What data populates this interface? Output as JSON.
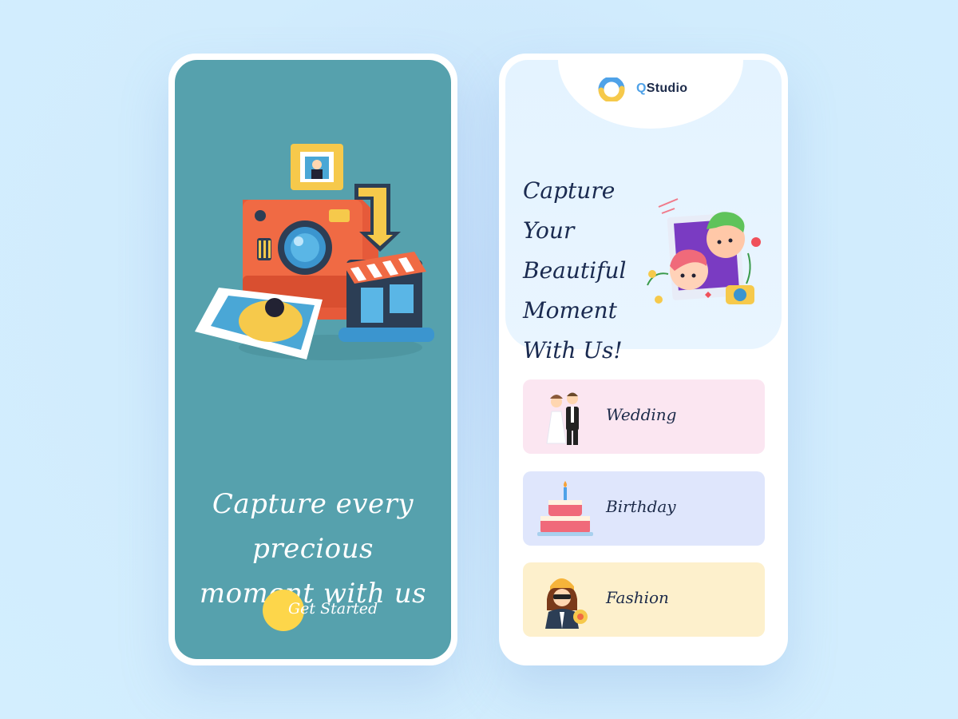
{
  "colors": {
    "background": "#d1ecfd",
    "left_screen": "#56a1ad",
    "accent_yellow": "#fdd64a",
    "text_dark": "#1d2b4a",
    "logo_blue": "#4fa2e8",
    "wedding_card": "#fbe6f1",
    "birthday_card": "#dfe6fc",
    "fashion_card": "#fdf0cc"
  },
  "left_screen": {
    "illustration": "instant-camera-illustration",
    "headline_line1": "Capture every precious",
    "headline_line2": "moment with us",
    "cta_label": "Get Started"
  },
  "right_screen": {
    "brand": {
      "logo_icon": "qstudio-logo-icon",
      "name_prefix": "Q",
      "name_rest": "Studio"
    },
    "hero": {
      "title_line1": "Capture Your",
      "title_line2": "Beautiful",
      "title_line3": "Moment",
      "title_line4": "With Us!",
      "illustration": "couple-photo-frame-illustration"
    },
    "categories": [
      {
        "label": "Wedding",
        "icon": "wedding-couple-icon"
      },
      {
        "label": "Birthday",
        "icon": "birthday-cake-icon"
      },
      {
        "label": "Fashion",
        "icon": "fashion-woman-icon"
      }
    ]
  }
}
